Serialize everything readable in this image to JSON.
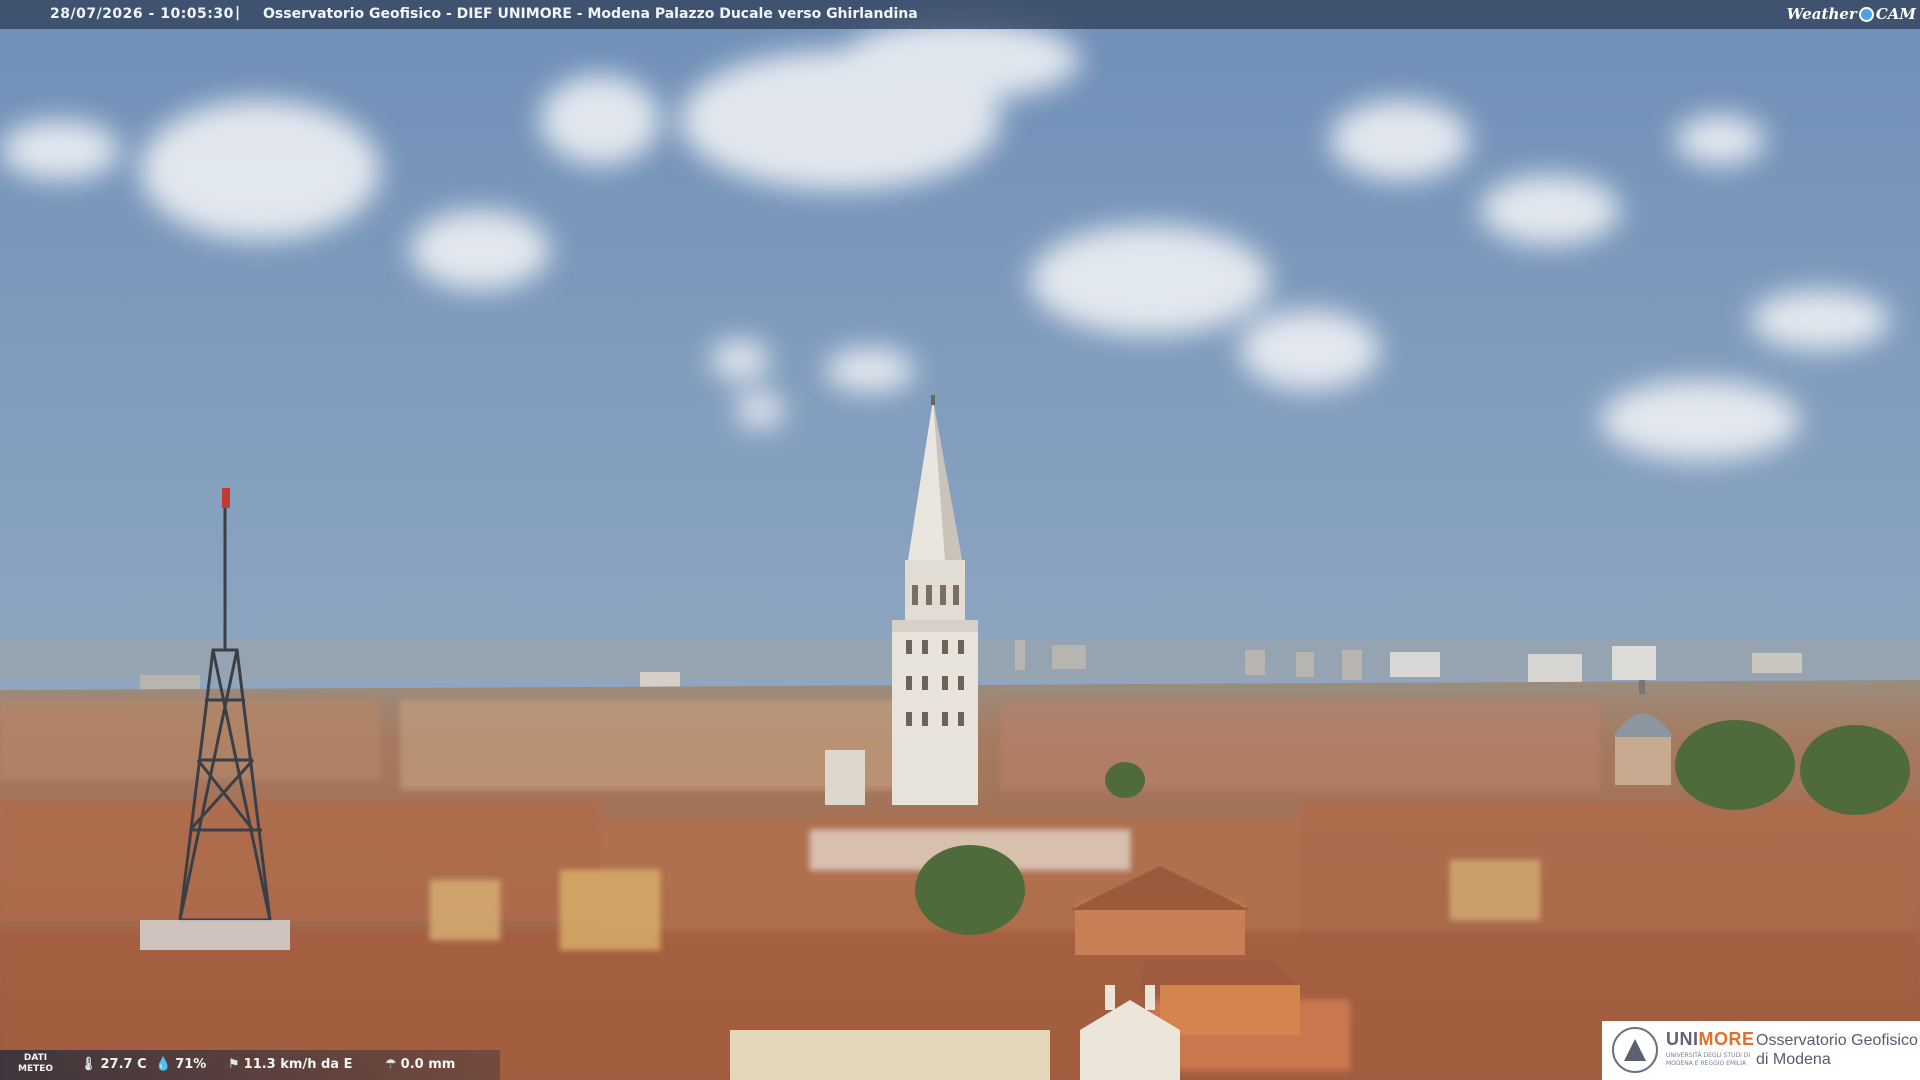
{
  "overlay": {
    "datetime": "28/07/2026 - 10:05:30",
    "separator": "|",
    "caption": "Osservatorio Geofisico - DIEF UNIMORE - Modena Palazzo Ducale verso Ghirlandina",
    "brand_left": "Weather",
    "brand_right": "CAM"
  },
  "weather": {
    "label_top": "DATI",
    "label_bottom": "METEO",
    "temperature": "27.7 C",
    "humidity": "71%",
    "wind": "11.3 km/h da E",
    "rain": "0.0 mm",
    "icons": [
      "thermometer-icon",
      "humidity-icon",
      "wind-icon",
      "rain-icon"
    ]
  },
  "logo": {
    "brand_a": "UNI",
    "brand_b": "MORE",
    "brand_sub": "UNIVERSITÀ DEGLI STUDI DI MODENA E REGGIO EMILIA",
    "observatory_line1": "Osservatorio Geofisico",
    "observatory_line2": "di Modena"
  },
  "colors": {
    "sky_top": "#7d9bc0",
    "sky_horizon": "#a9b4c0",
    "roof": "#b46d4c",
    "tower": "#e6e2dc"
  }
}
